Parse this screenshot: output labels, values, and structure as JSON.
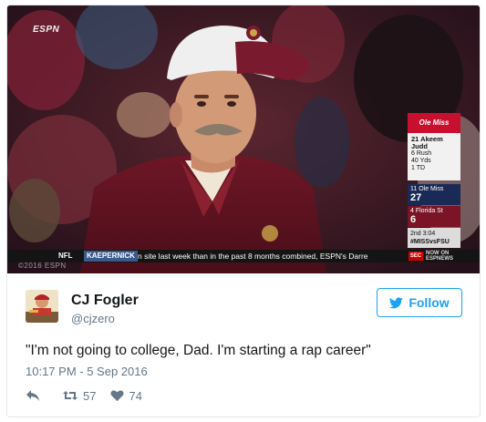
{
  "media": {
    "network_logo": "ESPN",
    "watermark": "©2016 ESPN",
    "scoreboard": {
      "team1_logo": "Ole Miss",
      "player_line1": "21 Akeem",
      "player_line2": "Judd",
      "stat1": "6 Rush",
      "stat2": "40 Yds",
      "stat3": "1 TD",
      "team1_label": "11 Ole Miss",
      "team1_score": "27",
      "team2_label": "4 Florida St",
      "team2_score": "6",
      "clock": "2nd 3:04",
      "hashtag": "#MISSvsFSU"
    },
    "ticker": {
      "league": "NFL",
      "tag": "KAEPERNICK",
      "text": "n site last week than in the past 8 months combined, ESPN's Darre",
      "sec_badge": "SEC",
      "now_label_1": "NOW ON",
      "now_label_2": "ESPNEWS"
    }
  },
  "tweet": {
    "display_name": "CJ Fogler",
    "handle": "@cjzero",
    "follow_label": "Follow",
    "text": "\"I'm not going to college, Dad. I'm starting a rap career\"",
    "timestamp": "10:17 PM - 5 Sep 2016",
    "retweets": "57",
    "likes": "74"
  },
  "colors": {
    "twitter_blue": "#1da1f2",
    "muted_text": "#657786",
    "border": "#e1e8ed"
  },
  "icons": {
    "follow": "twitter-bird-icon",
    "reply": "reply-icon",
    "retweet": "retweet-icon",
    "like": "heart-icon"
  }
}
